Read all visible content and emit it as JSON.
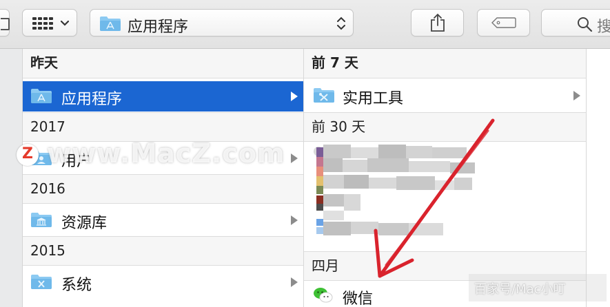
{
  "toolbar": {
    "path_label": "应用程序",
    "search_label": "搜"
  },
  "columns": {
    "left": {
      "groups": [
        {
          "header": "昨天",
          "items": [
            {
              "label": "应用程序",
              "selected": true
            }
          ]
        },
        {
          "header": "2017",
          "items": [
            {
              "label": "用户",
              "selected": false
            }
          ]
        },
        {
          "header": "2016",
          "items": [
            {
              "label": "资源库",
              "selected": false
            }
          ]
        },
        {
          "header": "2015",
          "items": [
            {
              "label": "系统",
              "selected": false
            }
          ]
        }
      ]
    },
    "middle": {
      "sections": [
        {
          "header": "前 7 天",
          "items": [
            {
              "label": "实用工具"
            }
          ]
        },
        {
          "header": "前 30 天"
        },
        {
          "header": "四月",
          "items": [
            {
              "label": "微信"
            }
          ]
        }
      ]
    }
  },
  "watermarks": {
    "main_text": "www.MacZ.com",
    "logo_letter": "Z",
    "corner_text": "百家号/Mac小叮"
  },
  "colors": {
    "selection": "#1b66d2",
    "folder": "#6fb9ea",
    "annotation_arrow": "#d9232d",
    "wechat": "#3ec034"
  }
}
